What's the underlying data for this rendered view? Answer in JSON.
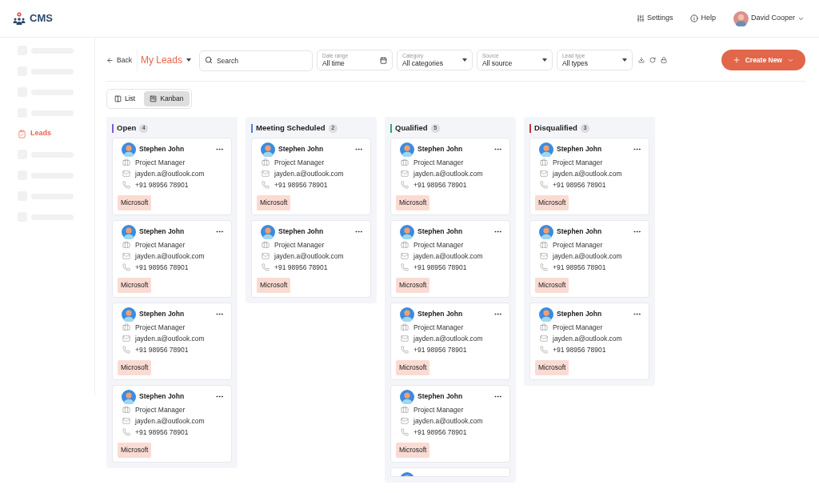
{
  "brand": {
    "name": "CMS"
  },
  "header_links": [
    {
      "kind": "settings",
      "label": "Settings"
    },
    {
      "kind": "help",
      "label": "Help"
    }
  ],
  "user": {
    "name": "David Cooper"
  },
  "sidebar": {
    "items": [
      {
        "kind": "skeleton"
      },
      {
        "kind": "skeleton"
      },
      {
        "kind": "skeleton"
      },
      {
        "kind": "skeleton"
      },
      {
        "kind": "link",
        "label": "Leads",
        "selected": true
      },
      {
        "kind": "skeleton"
      },
      {
        "kind": "skeleton"
      },
      {
        "kind": "skeleton"
      },
      {
        "kind": "skeleton"
      }
    ]
  },
  "toolbar": {
    "back": "Back",
    "title": "My Leads",
    "search": {
      "placeholder": "Search"
    },
    "filters": [
      {
        "label": "Date range",
        "value": "All time",
        "kind": "date"
      },
      {
        "label": "Category",
        "value": "All categories",
        "kind": "select"
      },
      {
        "label": "Source",
        "value": "All source",
        "kind": "select"
      },
      {
        "label": "Lead type",
        "value": "All types",
        "kind": "select"
      }
    ],
    "create": "Create New"
  },
  "views": [
    {
      "label": "List",
      "kind": "list",
      "selected": false
    },
    {
      "label": "Kanban",
      "kind": "kanban",
      "selected": true
    }
  ],
  "columns": [
    {
      "title": "Open",
      "count": "4",
      "color": "#7c5cd6",
      "cards": [
        {
          "kind": "lead",
          "name": "Stephen John",
          "role": "Project Manager",
          "email": "jayden.a@outlook.com",
          "phone": "+91 98956 78901",
          "company": "Microsoft"
        },
        {
          "kind": "lead",
          "name": "Stephen John",
          "role": "Project Manager",
          "email": "jayden.a@outlook.com",
          "phone": "+91 98956 78901",
          "company": "Microsoft"
        },
        {
          "kind": "lead",
          "name": "Stephen John",
          "role": "Project Manager",
          "email": "jayden.a@outlook.com",
          "phone": "+91 98956 78901",
          "company": "Microsoft"
        },
        {
          "kind": "lead",
          "name": "Stephen John",
          "role": "Project Manager",
          "email": "jayden.a@outlook.com",
          "phone": "+91 98956 78901",
          "company": "Microsoft"
        }
      ]
    },
    {
      "title": "Meeting Scheduled",
      "count": "2",
      "color": "#4a7fe0",
      "cards": [
        {
          "kind": "lead",
          "name": "Stephen John",
          "role": "Project Manager",
          "email": "jayden.a@outlook.com",
          "phone": "+91 98956 78901",
          "company": "Microsoft"
        },
        {
          "kind": "lead",
          "name": "Stephen John",
          "role": "Project Manager",
          "email": "jayden.a@outlook.com",
          "phone": "+91 98956 78901",
          "company": "Microsoft"
        }
      ]
    },
    {
      "title": "Qualified",
      "count": "5",
      "color": "#2aa57c",
      "cards": [
        {
          "kind": "lead",
          "name": "Stephen John",
          "role": "Project Manager",
          "email": "jayden.a@outlook.com",
          "phone": "+91 98956 78901",
          "company": "Microsoft"
        },
        {
          "kind": "lead",
          "name": "Stephen John",
          "role": "Project Manager",
          "email": "jayden.a@outlook.com",
          "phone": "+91 98956 78901",
          "company": "Microsoft"
        },
        {
          "kind": "lead",
          "name": "Stephen John",
          "role": "Project Manager",
          "email": "jayden.a@outlook.com",
          "phone": "+91 98956 78901",
          "company": "Microsoft"
        },
        {
          "kind": "lead",
          "name": "Stephen John",
          "role": "Project Manager",
          "email": "jayden.a@outlook.com",
          "phone": "+91 98956 78901",
          "company": "Microsoft"
        },
        {
          "kind": "peek"
        }
      ]
    },
    {
      "title": "Disqualified",
      "count": "3",
      "color": "#c0343a",
      "cards": [
        {
          "kind": "lead",
          "name": "Stephen John",
          "role": "Project Manager",
          "email": "jayden.a@outlook.com",
          "phone": "+91 98956 78901",
          "company": "Microsoft"
        },
        {
          "kind": "lead",
          "name": "Stephen John",
          "role": "Project Manager",
          "email": "jayden.a@outlook.com",
          "phone": "+91 98956 78901",
          "company": "Microsoft"
        },
        {
          "kind": "lead",
          "name": "Stephen John",
          "role": "Project Manager",
          "email": "jayden.a@outlook.com",
          "phone": "+91 98956 78901",
          "company": "Microsoft"
        }
      ]
    }
  ]
}
